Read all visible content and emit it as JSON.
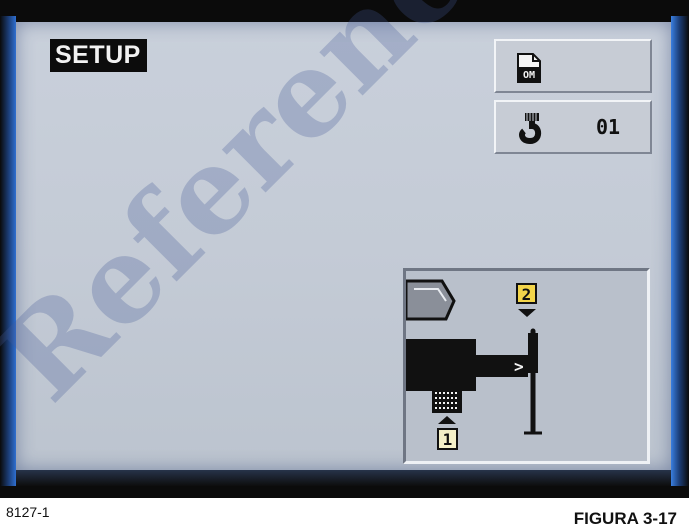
{
  "screen": {
    "title": "SETUP",
    "manual_button": {
      "icon": "operator-manual-icon",
      "icon_text": "OM"
    },
    "hook_button": {
      "icon": "hook-block-icon",
      "value": "01"
    },
    "diagram": {
      "marker_top": "2",
      "marker_bottom": "1",
      "arrow_glyph": ">"
    }
  },
  "watermark_text": "Referencia",
  "figure": {
    "id": "8127-1",
    "caption": "FIGURA 3-17"
  },
  "colors": {
    "screen_background": "#c6cdd8",
    "title_background": "#0c0c0c",
    "marker_yellow": "#f3d54a",
    "marker_cream": "#f4f0c8",
    "monitor_bezel_blue": "#2f6fd0"
  }
}
